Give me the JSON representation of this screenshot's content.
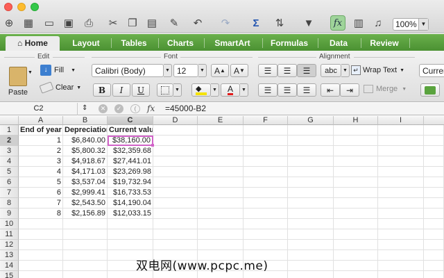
{
  "toolbar": {
    "zoom": "100%",
    "icons": [
      "new-icon",
      "gallery-icon",
      "open-icon",
      "save-icon",
      "print-icon",
      "cut-icon",
      "copy-icon",
      "paste-icon",
      "format-painter-icon",
      "undo-icon",
      "redo-icon",
      "autosum-icon",
      "sort-icon",
      "filter-icon",
      "formula-builder-icon",
      "toolbox-icon",
      "media-icon"
    ]
  },
  "ribbon_tabs": [
    "Home",
    "Layout",
    "Tables",
    "Charts",
    "SmartArt",
    "Formulas",
    "Data",
    "Review"
  ],
  "ribbon": {
    "groups": {
      "edit": "Edit",
      "font": "Font",
      "alignment": "Alignment"
    },
    "paste": "Paste",
    "fill": "Fill",
    "clear": "Clear",
    "font_name": "Calibri (Body)",
    "font_size": "12",
    "bold": "B",
    "italic": "I",
    "underline": "U",
    "wrap_text": "Wrap Text",
    "merge": "Merge",
    "abc": "abc",
    "number_format": "Curren"
  },
  "formula_bar": {
    "name_box": "C2",
    "fx": "fx",
    "formula": "=45000-B2"
  },
  "sheet": {
    "columns": [
      "A",
      "B",
      "C",
      "D",
      "E",
      "F",
      "G",
      "H",
      "I"
    ],
    "selected_column": "C",
    "selected_row": 2,
    "header_row": [
      "End of year",
      "Depreciation",
      "Current value"
    ],
    "rows": [
      [
        "1",
        "$6,840.00",
        "$38,160.00"
      ],
      [
        "2",
        "$5,800.32",
        "$32,359.68"
      ],
      [
        "3",
        "$4,918.67",
        "$27,441.01"
      ],
      [
        "4",
        "$4,171.03",
        "$23,269.98"
      ],
      [
        "5",
        "$3,537.04",
        "$19,732.94"
      ],
      [
        "6",
        "$2,999.41",
        "$16,733.53"
      ],
      [
        "7",
        "$2,543.50",
        "$14,190.04"
      ],
      [
        "8",
        "$2,156.89",
        "$12,033.15"
      ]
    ],
    "row_numbers": [
      "1",
      "2",
      "3",
      "4",
      "5",
      "6",
      "7",
      "8",
      "9",
      "10",
      "11",
      "12",
      "13",
      "14",
      "15"
    ]
  },
  "watermark": "双电网(www.pcpc.me)",
  "colors": {
    "ribbon_green": "#5aa33e",
    "selection": "#d163c8"
  }
}
